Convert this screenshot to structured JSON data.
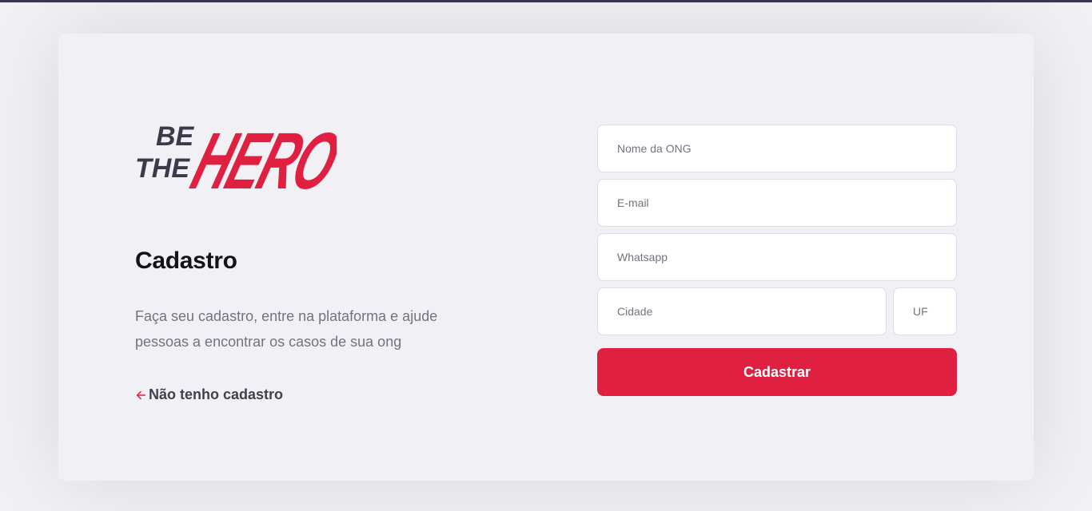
{
  "logo": {
    "text_small_1": "BE",
    "text_small_2": "THE",
    "text_big": "HERO",
    "color_dark": "#3a3a48",
    "color_brand": "#e02041"
  },
  "page": {
    "title": "Cadastro",
    "description": "Faça seu cadastro, entre na plataforma e ajude pessoas a encontrar os casos de sua ong",
    "back_link": "Não tenho cadastro",
    "back_icon": "arrow-left-icon"
  },
  "form": {
    "name_placeholder": "Nome da ONG",
    "email_placeholder": "E-mail",
    "whatsapp_placeholder": "Whatsapp",
    "city_placeholder": "Cidade",
    "uf_placeholder": "UF",
    "submit_label": "Cadastrar"
  },
  "colors": {
    "accent": "#e02041",
    "background": "#f0f0f5",
    "text_dark": "#13131a",
    "text_muted": "#737380"
  }
}
